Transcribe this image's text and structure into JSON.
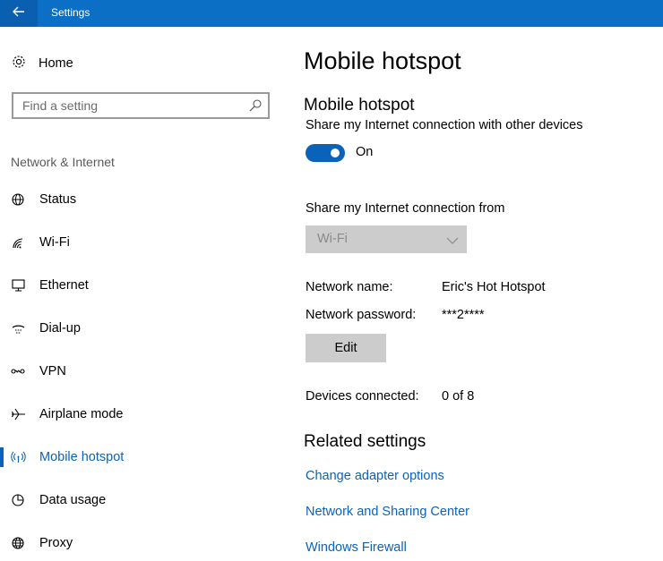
{
  "window": {
    "title": "Settings"
  },
  "sidebar": {
    "home_label": "Home",
    "search_placeholder": "Find a setting",
    "section_heading": "Network & Internet",
    "items": [
      {
        "label": "Status",
        "icon": "status-icon"
      },
      {
        "label": "Wi-Fi",
        "icon": "wifi-icon"
      },
      {
        "label": "Ethernet",
        "icon": "ethernet-icon"
      },
      {
        "label": "Dial-up",
        "icon": "dialup-icon"
      },
      {
        "label": "VPN",
        "icon": "vpn-icon"
      },
      {
        "label": "Airplane mode",
        "icon": "airplane-icon"
      },
      {
        "label": "Mobile hotspot",
        "icon": "hotspot-icon",
        "active": true
      },
      {
        "label": "Data usage",
        "icon": "data-usage-icon"
      },
      {
        "label": "Proxy",
        "icon": "globe-icon"
      }
    ]
  },
  "main": {
    "page_title": "Mobile hotspot",
    "section_title": "Mobile hotspot",
    "share_description": "Share my Internet connection with other devices",
    "toggle_state": "On",
    "share_from_label": "Share my Internet connection from",
    "share_from_value": "Wi-Fi",
    "network_name_label": "Network name:",
    "network_name_value": "Eric's Hot Hotspot",
    "network_password_label": "Network password:",
    "network_password_value": "***2****",
    "edit_label": "Edit",
    "devices_label": "Devices connected:",
    "devices_value": "0 of 8",
    "related_title": "Related settings",
    "links": [
      "Change adapter options",
      "Network and Sharing Center",
      "Windows Firewall"
    ]
  },
  "colors": {
    "accent": "#0a63b8",
    "titlebar": "#0b6fc5",
    "disabled_control": "#cccccc"
  }
}
